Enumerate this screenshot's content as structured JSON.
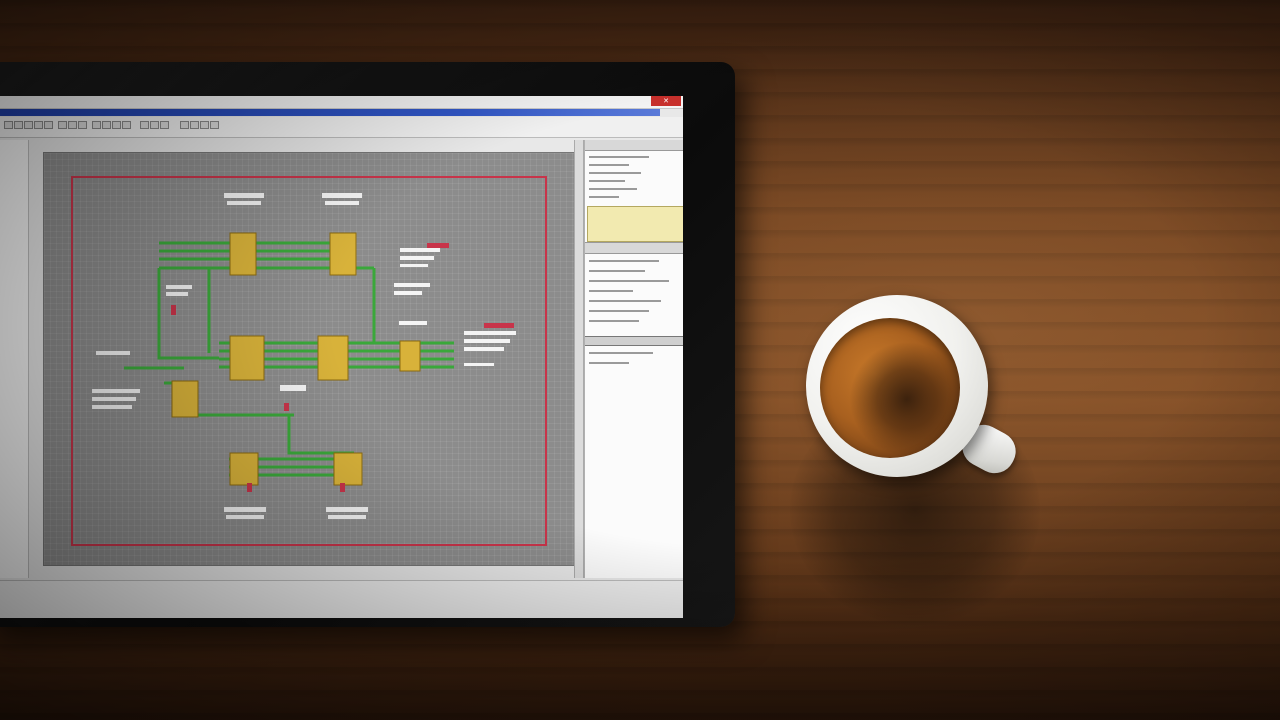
{
  "scene": {
    "description_tags": [
      "wood-desk",
      "tablet",
      "coffee-cup"
    ],
    "colors": {
      "desk": "#6e3e1c",
      "menubar": "#1f3fa8",
      "sheet_border": "#c8344a",
      "wire": "#3aa83a",
      "component": "#d8b23a",
      "coffee": "#a8601f"
    }
  },
  "app": {
    "title": "",
    "close_icon": "close-icon"
  }
}
